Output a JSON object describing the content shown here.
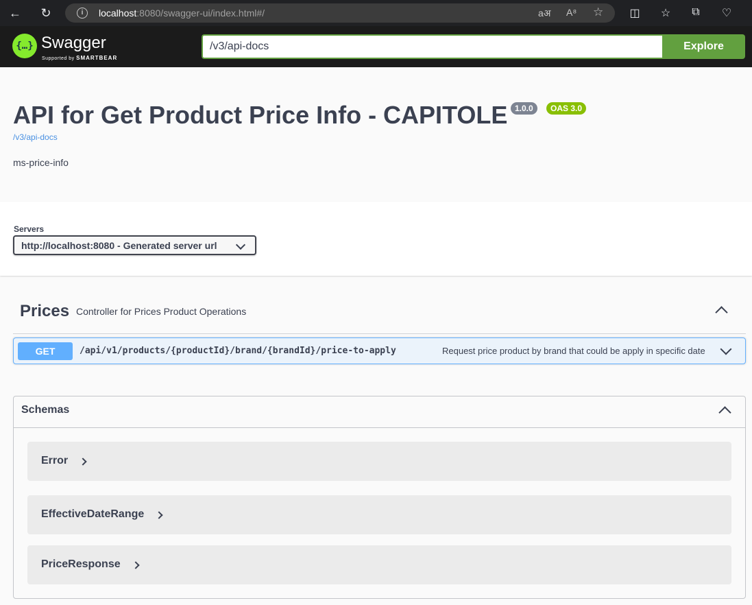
{
  "browser": {
    "url_host": "localhost",
    "url_path": ":8080/swagger-ui/index.html#/"
  },
  "topbar": {
    "logo_text": "Swagger",
    "logo_sub_prefix": "Supported by",
    "logo_sub_brand": "SMARTBEAR",
    "logo_glyph": "{…}",
    "spec_url": "/v3/api-docs",
    "explore_label": "Explore"
  },
  "info": {
    "title": "API for Get Product Price Info - CAPITOLE",
    "version": "1.0.0",
    "oas": "OAS 3.0",
    "spec_link": "/v3/api-docs",
    "description": "ms-price-info"
  },
  "servers": {
    "label": "Servers",
    "selected": "http://localhost:8080 - Generated server url"
  },
  "tag": {
    "name": "Prices",
    "description": "Controller for Prices Product Operations"
  },
  "operation": {
    "method": "GET",
    "path": "/api/v1/products/{productId}/brand/{brandId}/price-to-apply",
    "summary": "Request price product by brand that could be apply in specific date"
  },
  "schemas": {
    "title": "Schemas",
    "items": [
      "Error",
      "EffectiveDateRange",
      "PriceResponse"
    ]
  },
  "colors": {
    "accent_green": "#62a03f",
    "get_blue": "#61affe",
    "oas_badge": "#89bf04",
    "version_badge": "#7d8492"
  }
}
